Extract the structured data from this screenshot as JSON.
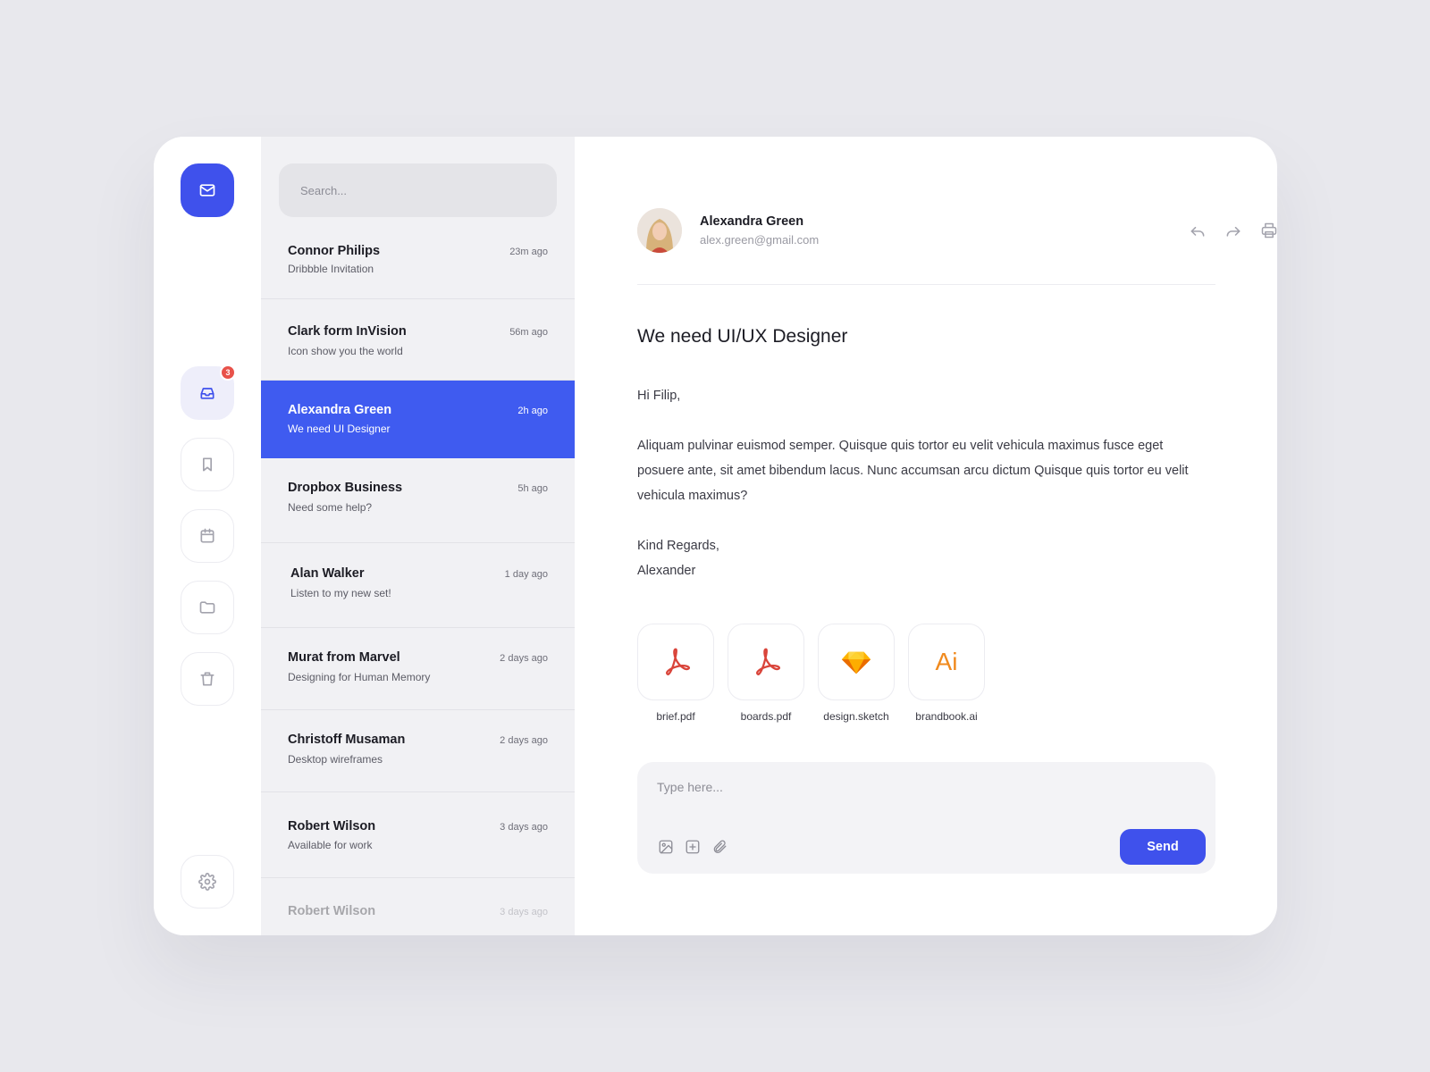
{
  "colors": {
    "accent": "#3f51ec",
    "badge": "#e8524a",
    "pdf": "#d9443a",
    "ai": "#f08a1e",
    "sketch": "#f7b81b"
  },
  "rail": {
    "items": [
      {
        "icon": "mail-icon"
      },
      {
        "icon": "inbox-icon",
        "badge": "3"
      },
      {
        "icon": "bookmark-icon"
      },
      {
        "icon": "calendar-icon"
      },
      {
        "icon": "folder-icon"
      },
      {
        "icon": "trash-icon"
      },
      {
        "icon": "settings-icon"
      }
    ]
  },
  "search": {
    "placeholder": "Search..."
  },
  "messages": [
    {
      "name": "Connor Philips",
      "time": "23m ago",
      "subject": "Dribbble Invitation"
    },
    {
      "name": "Clark form InVision",
      "time": "56m ago",
      "subject": "Icon show you the world"
    },
    {
      "name": "Alexandra Green",
      "time": "2h ago",
      "subject": "We need UI Designer"
    },
    {
      "name": "Dropbox Business",
      "time": "5h ago",
      "subject": "Need some help?"
    },
    {
      "name": "Alan Walker",
      "time": "1 day ago",
      "subject": "Listen to my new set!"
    },
    {
      "name": "Murat from Marvel",
      "time": "2 days ago",
      "subject": "Designing for Human Memory"
    },
    {
      "name": "Christoff Musaman",
      "time": "2 days ago",
      "subject": "Desktop wireframes"
    },
    {
      "name": "Robert Wilson",
      "time": "3 days ago",
      "subject": "Available for work"
    },
    {
      "name": "Robert Wilson",
      "time": "3 days ago",
      "subject": ""
    }
  ],
  "reader": {
    "sender": {
      "name": "Alexandra Green",
      "email": "alex.green@gmail.com"
    },
    "actions": [
      "reply-icon",
      "forward-icon",
      "print-icon",
      "trash-icon",
      "bookmark-icon"
    ],
    "subject": "We need UI/UX Designer",
    "greeting": "Hi Filip,",
    "body": "Aliquam pulvinar euismod semper. Quisque quis tortor eu velit vehicula maximus fusce eget posuere ante, sit amet bibendum lacus. Nunc accumsan arcu dictum Quisque quis tortor eu velit vehicula maximus?",
    "signoff": "Kind Regards,",
    "signature": "Alexander",
    "attachments": [
      {
        "label": "brief.pdf",
        "icon": "pdf-icon"
      },
      {
        "label": "boards.pdf",
        "icon": "pdf-icon"
      },
      {
        "label": "design.sketch",
        "icon": "sketch-icon"
      },
      {
        "label": "brandbook.ai",
        "icon": "illustrator-icon",
        "glyph": "Ai"
      }
    ]
  },
  "composer": {
    "placeholder": "Type here...",
    "tools": [
      "image-icon",
      "add-icon",
      "paperclip-icon"
    ],
    "send_label": "Send"
  }
}
